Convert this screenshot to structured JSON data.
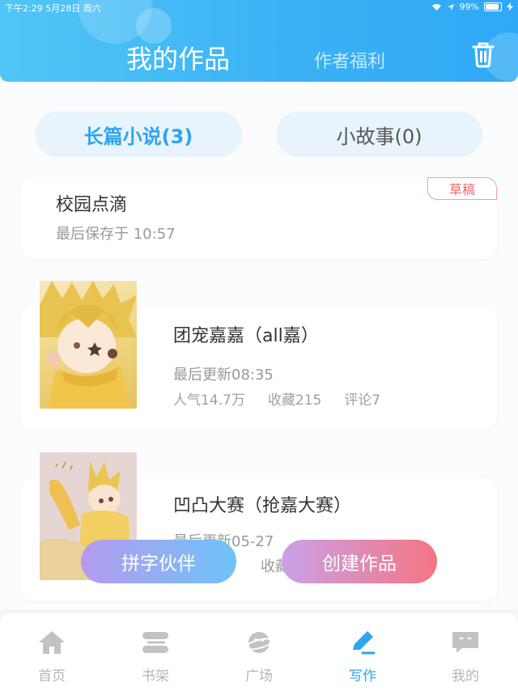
{
  "status_bar": {
    "time_date": "下午2:29   5月28日 周六",
    "battery": "99%"
  },
  "header": {
    "tab_active": "我的作品",
    "tab_inactive": "作者福利",
    "trash_icon": "trash-icon"
  },
  "segments": {
    "long": "长篇小说(3)",
    "short": "小故事(0)"
  },
  "works": [
    {
      "title": "校园点滴",
      "subtitle": "最后保存于 10:57",
      "tag": "草稿"
    },
    {
      "title": "团宠嘉嘉（all嘉）",
      "updated": "最后更新08:35",
      "popularity": "人气14.7万",
      "favorites": "收藏215",
      "comments": "评论7"
    },
    {
      "title": "凹凸大赛（抢嘉大赛）",
      "updated": "最后更新05-27",
      "favorites_partial": "收藏"
    }
  ],
  "fabs": {
    "left": "拼字伙伴",
    "right": "创建作品"
  },
  "tabbar": [
    {
      "label": "首页",
      "icon": "home-icon"
    },
    {
      "label": "书架",
      "icon": "bookshelf-icon"
    },
    {
      "label": "广场",
      "icon": "planet-icon"
    },
    {
      "label": "写作",
      "icon": "pen-icon"
    },
    {
      "label": "我的",
      "icon": "chat-bubble-icon"
    }
  ],
  "colors": {
    "accent": "#2ea5ee",
    "header_gradient_start": "#51c6f6",
    "header_gradient_end": "#2ea9f6",
    "draft_tag": "#ee6a6a",
    "fab_left_gradient": [
      "#b59bf0",
      "#6ec3f7"
    ],
    "fab_right_gradient": [
      "#c9a1e8",
      "#f57583"
    ]
  }
}
